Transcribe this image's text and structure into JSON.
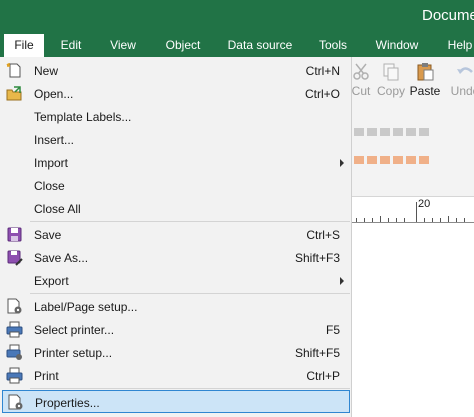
{
  "window": {
    "title": "Docume"
  },
  "menubar": {
    "items": [
      {
        "id": "file",
        "label": "File",
        "active": true
      },
      {
        "id": "edit",
        "label": "Edit"
      },
      {
        "id": "view",
        "label": "View"
      },
      {
        "id": "object",
        "label": "Object"
      },
      {
        "id": "data-source",
        "label": "Data source"
      },
      {
        "id": "tools",
        "label": "Tools"
      },
      {
        "id": "window",
        "label": "Window"
      },
      {
        "id": "help",
        "label": "Help"
      }
    ]
  },
  "ribbon": {
    "cut": {
      "label": "Cut",
      "icon": "scissors-icon",
      "enabled": false
    },
    "copy": {
      "label": "Copy",
      "icon": "copy-icon",
      "enabled": false
    },
    "paste": {
      "label": "Paste",
      "icon": "clipboard-icon",
      "enabled": true
    },
    "undo": {
      "label": "Undo",
      "icon": "undo-icon",
      "enabled": false
    }
  },
  "ruler": {
    "mark": "20"
  },
  "file_menu": {
    "items": [
      {
        "id": "new",
        "label": "New",
        "shortcut": "Ctrl+N",
        "icon": "new-document-icon"
      },
      {
        "id": "open",
        "label": "Open...",
        "shortcut": "Ctrl+O",
        "icon": "open-folder-icon"
      },
      {
        "id": "template-labels",
        "label": "Template Labels...",
        "shortcut": ""
      },
      {
        "id": "insert",
        "label": "Insert...",
        "shortcut": ""
      },
      {
        "id": "import",
        "label": "Import",
        "shortcut": "",
        "submenu": true
      },
      {
        "id": "close",
        "label": "Close",
        "shortcut": ""
      },
      {
        "id": "close-all",
        "label": "Close All",
        "shortcut": ""
      },
      {
        "id": "save",
        "label": "Save",
        "shortcut": "Ctrl+S",
        "icon": "save-disk-icon"
      },
      {
        "id": "save-as",
        "label": "Save As...",
        "shortcut": "Shift+F3",
        "icon": "save-as-disk-icon"
      },
      {
        "id": "export",
        "label": "Export",
        "shortcut": "",
        "submenu": true
      },
      {
        "id": "label-page-setup",
        "label": "Label/Page setup...",
        "shortcut": "",
        "icon": "page-setup-icon"
      },
      {
        "id": "select-printer",
        "label": "Select printer...",
        "shortcut": "F5",
        "icon": "printer-select-icon"
      },
      {
        "id": "printer-setup",
        "label": "Printer setup...",
        "shortcut": "Shift+F5",
        "icon": "printer-setup-icon"
      },
      {
        "id": "print",
        "label": "Print",
        "shortcut": "Ctrl+P",
        "icon": "printer-icon"
      },
      {
        "id": "properties",
        "label": "Properties...",
        "shortcut": "",
        "icon": "properties-icon",
        "highlighted": true
      }
    ]
  },
  "colors": {
    "title_bar": "#217346",
    "menu_background": "#f2f2f2",
    "highlight_fill": "#cce4f7",
    "highlight_border": "#2f86d1"
  }
}
